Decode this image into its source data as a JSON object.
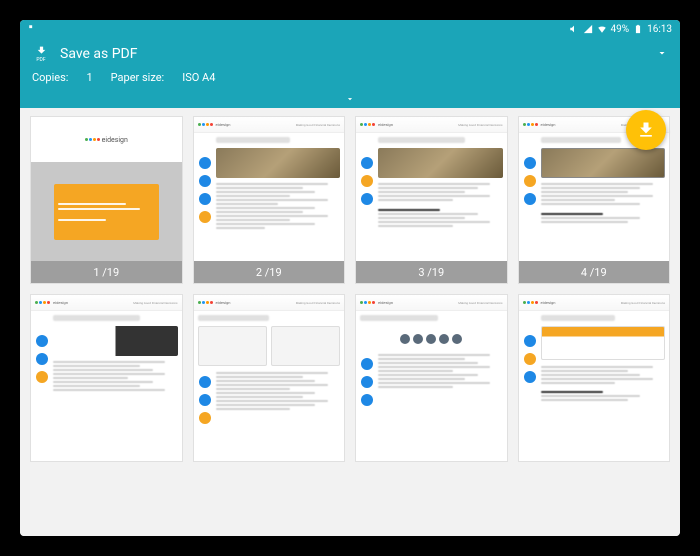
{
  "status": {
    "battery": "49%",
    "time": "16:13"
  },
  "header": {
    "title": "Save as PDF",
    "copies_label": "Copies:",
    "copies_value": "1",
    "papersize_label": "Paper size:",
    "papersize_value": "ISO A4"
  },
  "fab": {
    "name": "print-pdf"
  },
  "thumb_common": {
    "brand": "eidesign",
    "subtitle": "Making Good Financial Decisions"
  },
  "pages": [
    {
      "pager": "1 /19",
      "type": "cover"
    },
    {
      "pager": "2 /19",
      "type": "content"
    },
    {
      "pager": "3 /19",
      "type": "content"
    },
    {
      "pager": "4 /19",
      "type": "content"
    }
  ]
}
